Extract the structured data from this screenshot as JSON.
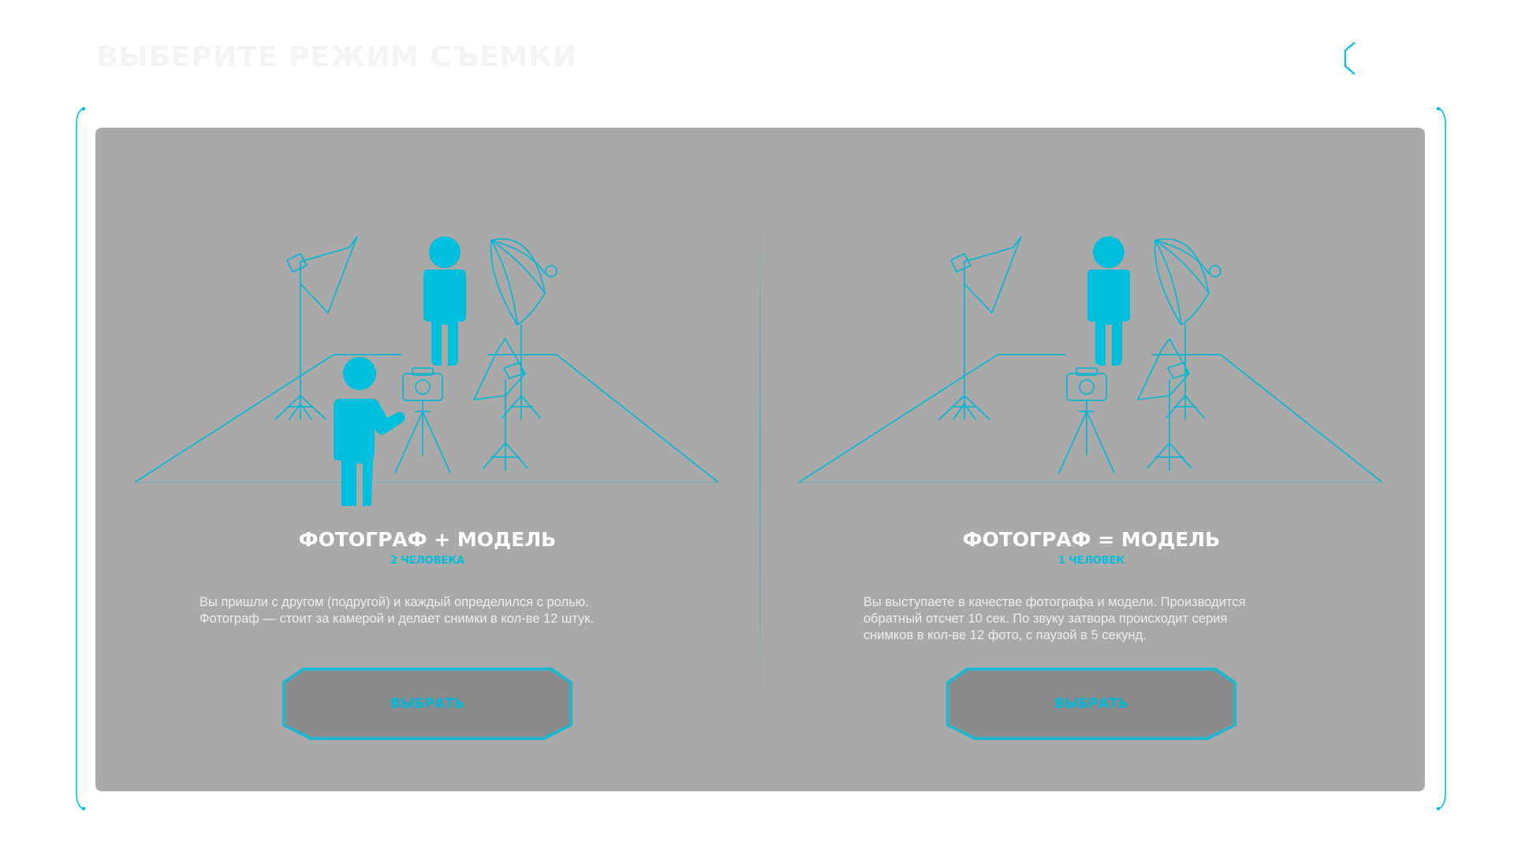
{
  "header": {
    "title": "ВЫБЕРИТЕ РЕЖИМ СЪЕМКИ",
    "back_icon": "chevron-left-hexagon-icon"
  },
  "colors": {
    "accent": "#00bfdc",
    "panel": "#a9a9a9",
    "button_fill": "#8a8a8a",
    "title_text": "#ffffff"
  },
  "modes": [
    {
      "title": "ФОТОГРАФ + МОДЕЛЬ",
      "subtitle": "2 ЧЕЛОВЕКА",
      "description_lines": [
        "Вы пришли с другом (подругой) и каждый определился с ролью.",
        "Фотограф — стоит за камерой и делает снимки в кол-ве 12 штук."
      ],
      "button_label": "ВЫБРАТЬ"
    },
    {
      "title": "ФОТОГРАФ = МОДЕЛЬ",
      "subtitle": "1 ЧЕЛОВЕК",
      "description_lines": [
        "Вы выступаете в качестве фотографа и модели. Производится",
        "обратный отсчет 10 сек. По звуку затвора происходит серия",
        "снимков в кол-ве 12 фото, с паузой в 5 секунд."
      ],
      "button_label": "ВЫБРАТЬ"
    }
  ]
}
